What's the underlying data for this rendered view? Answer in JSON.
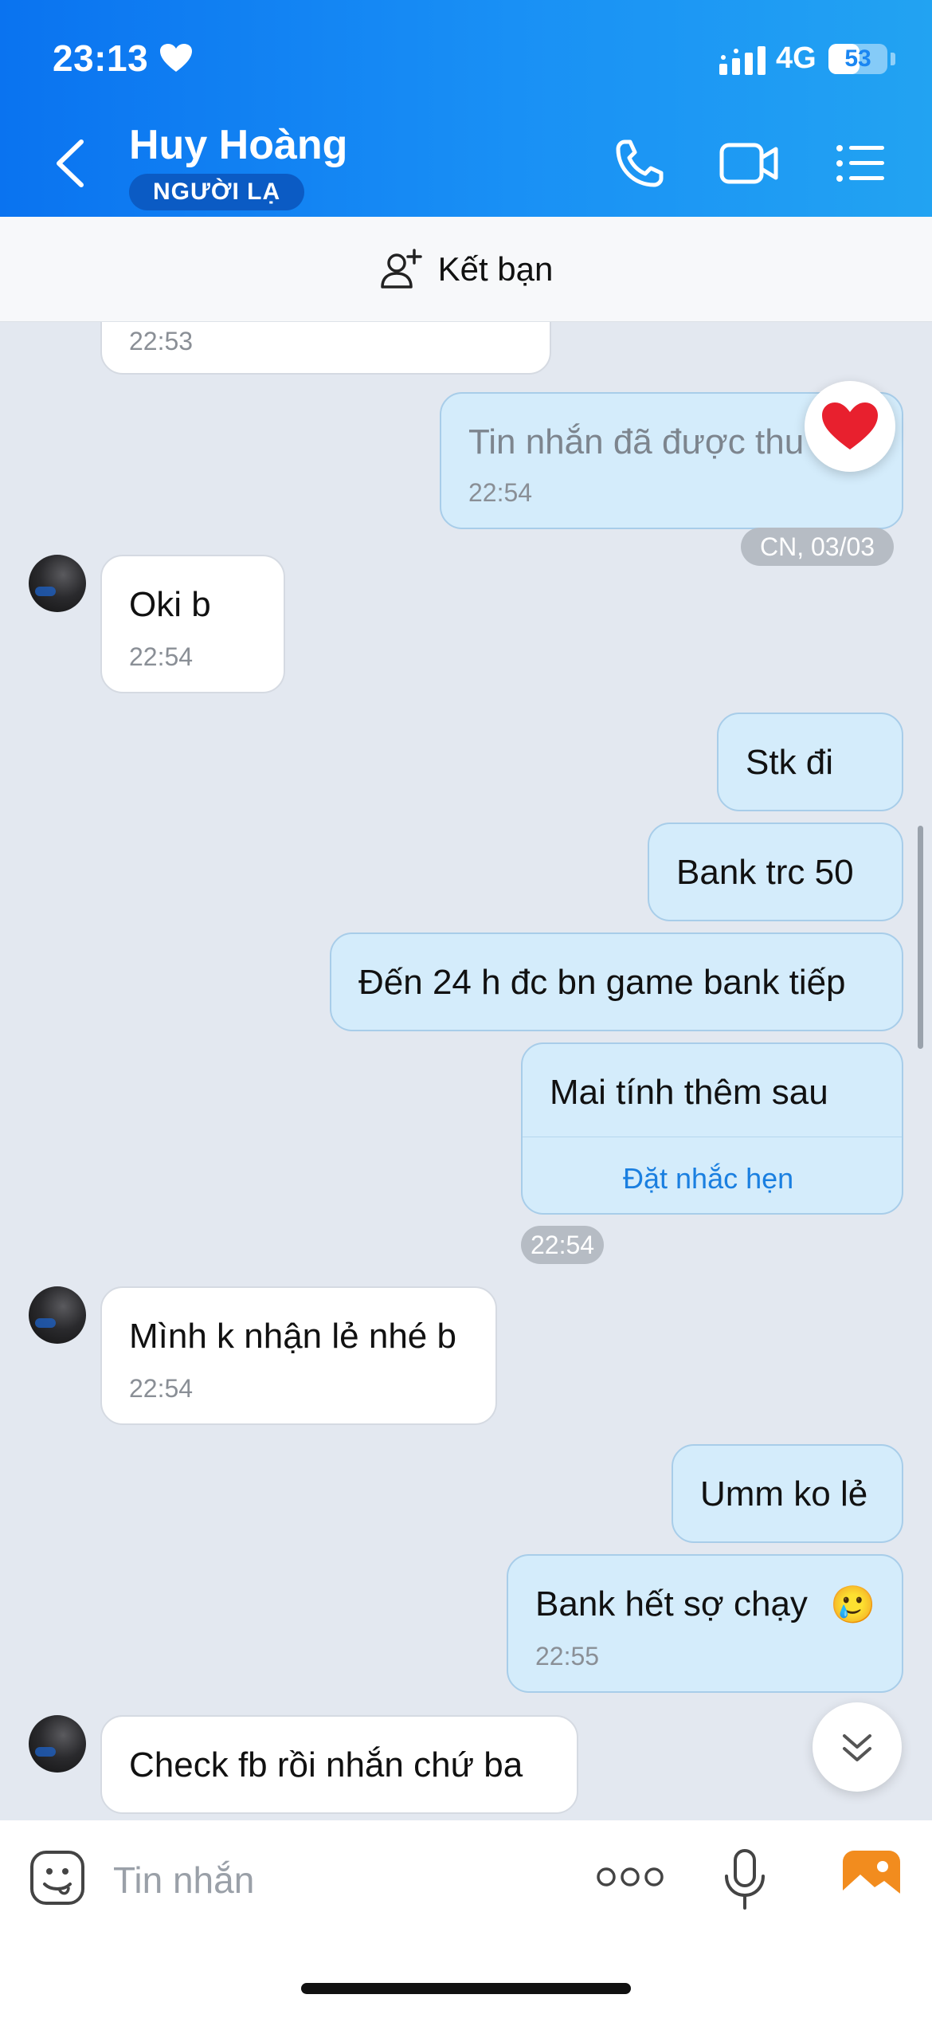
{
  "status_bar": {
    "time": "23:13",
    "network": "4G",
    "battery": "53",
    "battery_level": 0.53
  },
  "header": {
    "contact_name": "Huy Hoàng",
    "badge": "NGƯỜI LẠ"
  },
  "friend_bar": {
    "label": "Kết bạn"
  },
  "messages": {
    "m0_time": "22:53",
    "m1_text": "Tin nhắn đã được thu",
    "m1_time": "22:54",
    "m1_reaction": "heart",
    "date_pill": "CN, 03/03",
    "m2_text": "Oki b",
    "m2_time": "22:54",
    "m3_text": "Stk đi",
    "m4_text": "Bank trc 50",
    "m5_text": "Đến 24 h đc bn game bank tiếp",
    "m6_text": "Mai tính thêm sau",
    "m6_action": "Đặt nhắc hẹn",
    "group_time": "22:54",
    "m7_text": "Mình k nhận lẻ nhé b",
    "m7_time": "22:54",
    "m8_text": "Umm ko lẻ",
    "m9_text": "Bank hết sợ chạy",
    "m9_emoji": "🥲",
    "m9_time": "22:55",
    "m10_text": "Check fb rồi nhắn chứ ba"
  },
  "input": {
    "placeholder": "Tin nhắn"
  },
  "colors": {
    "header_start": "#0a73f0",
    "header_end": "#22a3f2",
    "outgoing": "#d4ecfb",
    "incoming": "#ffffff",
    "chat_bg": "#e3e8f0",
    "reaction": "#e8202e"
  },
  "icons": [
    "chevron-left-icon",
    "phone-icon",
    "video-call-icon",
    "menu-list-icon",
    "add-friend-icon",
    "heart-icon",
    "chevron-double-down-icon",
    "sticker-icon",
    "more-icon",
    "microphone-icon",
    "image-gallery-icon"
  ]
}
